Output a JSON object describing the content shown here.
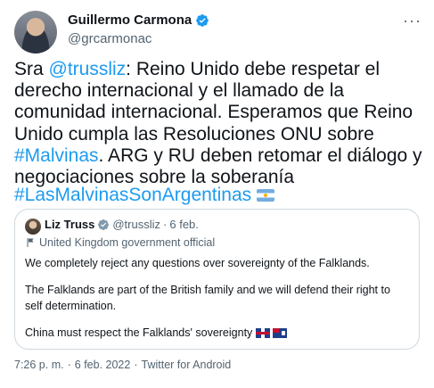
{
  "tweet": {
    "author_name": "Guillermo Carmona",
    "author_handle": "@grcarmonac",
    "more_icon": "···",
    "text": {
      "prefix": "Sra ",
      "mention": "@trussliz",
      "part1": ": Reino Unido debe respetar el derecho internacional y el llamado de la comunidad internacional. Esperamos que Reino Unido cumpla las Resoluciones ONU sobre ",
      "hashtag_inline": "#Malvinas",
      "part2": ". ARG y RU deben retomar el diálogo y negociaciones sobre la soberanía"
    },
    "hashtag_line": "#LasMalvinasSonArgentinas",
    "flag_icon": "argentina-flag-icon",
    "time": "7:26 p. m.",
    "sep": "·",
    "date": "6 feb. 2022",
    "source": "Twitter for Android"
  },
  "quote": {
    "name": "Liz Truss",
    "handle": "@trussliz",
    "sep": "·",
    "date": "6 feb.",
    "affiliation": "United Kingdom government official",
    "para1": "We completely reject any questions over sovereignty of the Falklands.",
    "para2": "The Falklands are part of the British family and we will defend their right to self determination.",
    "para3": "China must respect the Falklands' sovereignty"
  },
  "colors": {
    "accent": "#1d9bf0",
    "text": "#0f1419",
    "secondary": "#536471",
    "border": "#cfd9de"
  }
}
